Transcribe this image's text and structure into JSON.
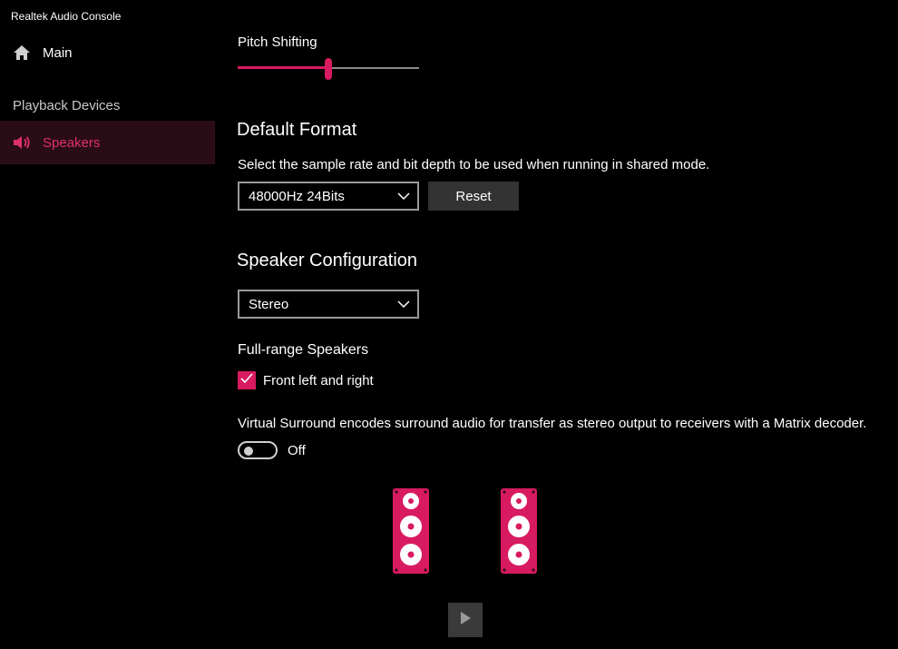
{
  "window": {
    "title": "Realtek Audio Console"
  },
  "sidebar": {
    "main_label": "Main",
    "section_label": "Playback Devices",
    "speakers_label": "Speakers"
  },
  "pitch": {
    "label": "Pitch Shifting",
    "value_fraction": 0.5
  },
  "default_format": {
    "heading": "Default Format",
    "description": "Select the sample rate and bit depth to be used when running in shared mode.",
    "selected": "48000Hz 24Bits",
    "reset_label": "Reset"
  },
  "speaker_config": {
    "heading": "Speaker Configuration",
    "selected": "Stereo",
    "full_range_label": "Full-range Speakers",
    "front_label": "Front left and right",
    "front_checked": true
  },
  "virtual_surround": {
    "description": "Virtual Surround encodes surround audio for transfer as stereo output to receivers with a Matrix decoder.",
    "state_label": "Off"
  },
  "icons": {
    "home": "home-icon",
    "speaker": "speaker-icon",
    "chevron": "chevron-down-icon",
    "check": "check-icon",
    "play": "play-icon"
  },
  "colors": {
    "accent": "#d81b60",
    "selected_bg": "#2a0c17",
    "background": "#000000"
  }
}
